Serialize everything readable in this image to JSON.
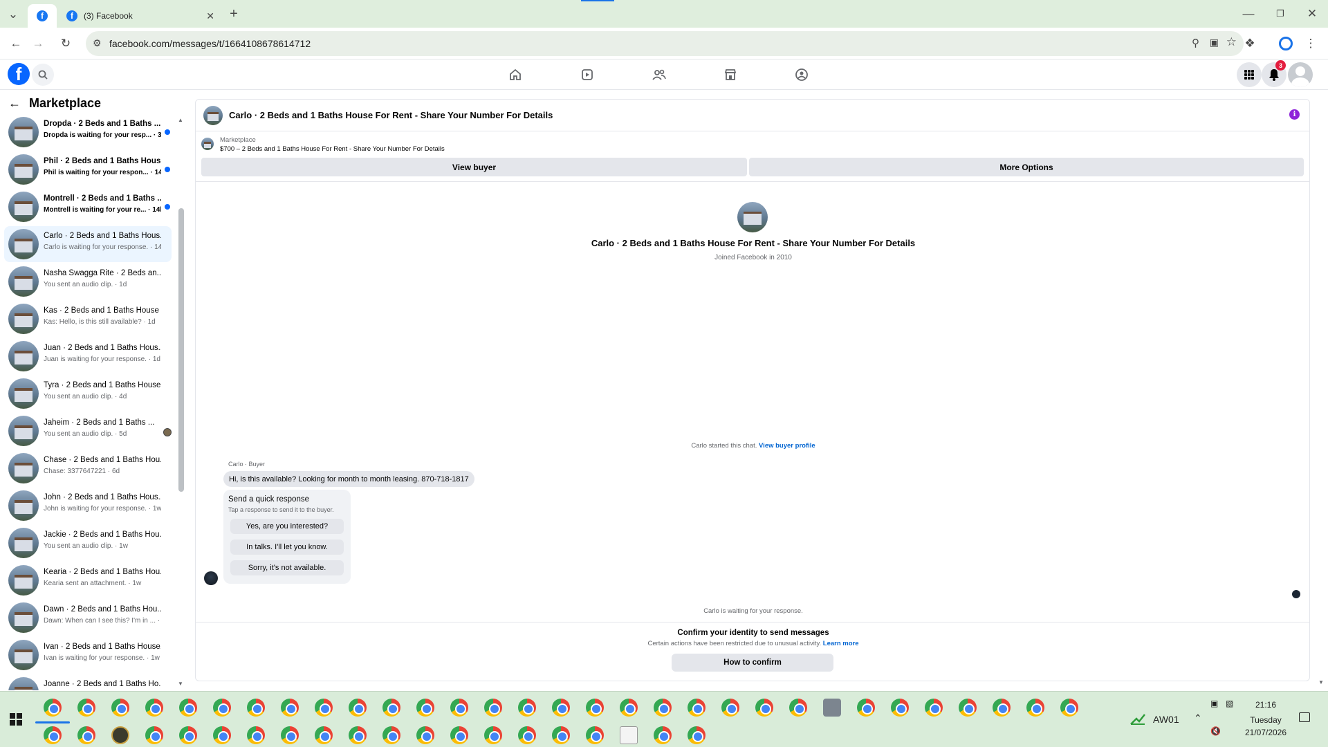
{
  "browser": {
    "tab_title": "(3) Facebook",
    "url": "facebook.com/messages/t/1664108678614712"
  },
  "fb": {
    "notification_count": "3"
  },
  "sidebar": {
    "title": "Marketplace",
    "conversations": [
      {
        "name": "Dropda · 2 Beds and 1 Baths ...",
        "snippet": "Dropda is waiting for your resp... · 3h",
        "unread": true
      },
      {
        "name": "Phil · 2 Beds and 1 Baths Hous...",
        "snippet": "Phil is waiting for your respon... · 14h",
        "unread": true
      },
      {
        "name": "Montrell · 2 Beds and 1 Baths ...",
        "snippet": "Montrell is waiting for your re... · 14h",
        "unread": true
      },
      {
        "name": "Carlo · 2 Beds and 1 Baths Hous...",
        "snippet": "Carlo is waiting for your response. · 14h",
        "selected": true
      },
      {
        "name": "Nasha Swagga Rite · 2 Beds an...",
        "snippet": "You sent an audio clip. · 1d"
      },
      {
        "name": "Kas · 2 Beds and 1 Baths House ...",
        "snippet": "Kas: Hello, is this still available? · 1d"
      },
      {
        "name": "Juan · 2 Beds and 1 Baths Hous...",
        "snippet": "Juan is waiting for your response. · 1d"
      },
      {
        "name": "Tyra · 2 Beds and 1 Baths House...",
        "snippet": "You sent an audio clip. · 4d"
      },
      {
        "name": "Jaheim · 2 Beds and 1 Baths ...",
        "snippet": "You sent an audio clip. · 5d",
        "seen": true
      },
      {
        "name": "Chase · 2 Beds and 1 Baths Hou...",
        "snippet": "Chase: 3377647221 · 6d"
      },
      {
        "name": "John · 2 Beds and 1 Baths Hous...",
        "snippet": "John is waiting for your response. · 1w"
      },
      {
        "name": "Jackie · 2 Beds and 1 Baths Hou...",
        "snippet": "You sent an audio clip. · 1w"
      },
      {
        "name": "Kearia · 2 Beds and 1 Baths Hou...",
        "snippet": "Kearia sent an attachment. · 1w"
      },
      {
        "name": "Dawn · 2 Beds and 1 Baths Hou...",
        "snippet": "Dawn: When can I see this? I'm in ... · 1w"
      },
      {
        "name": "Ivan · 2 Beds and 1 Baths House...",
        "snippet": "Ivan is waiting for your response. · 1w"
      },
      {
        "name": "Joanne · 2 Beds and 1 Baths Ho...",
        "snippet": ""
      }
    ]
  },
  "chat": {
    "title": "Carlo · 2 Beds and 1 Baths House For Rent - Share Your Number For Details",
    "listing_label": "Marketplace",
    "listing_detail": "$700 – 2 Beds and 1 Baths House For Rent - Share Your Number For Details",
    "view_buyer": "View buyer",
    "more_options": "More Options",
    "profile_name": "Carlo · 2 Beds and 1 Baths House For Rent - Share Your Number For Details",
    "joined": "Joined Facebook in 2010",
    "started_text": "Carlo started this chat.",
    "view_buyer_profile": "View buyer profile",
    "sender_label": "Carlo · Buyer",
    "message": "Hi, is this available? Looking for month to month leasing. 870-718-1817",
    "quick_title": "Send a quick response",
    "quick_sub": "Tap a response to send it to the buyer.",
    "quick_responses": [
      "Yes, are you interested?",
      "In talks. I'll let you know.",
      "Sorry, it's not available."
    ],
    "waiting": "Carlo is waiting for your response.",
    "confirm_title": "Confirm your identity to send messages",
    "confirm_sub": "Certain actions have been restricted due to unusual activity.",
    "learn_more": "Learn more",
    "how_to_confirm": "How to confirm"
  },
  "taskbar": {
    "network_label": "AW01",
    "time": "21:16",
    "day": "Tuesday",
    "date": "21/07/2026"
  },
  "icons": [
    "facebook-logo-icon",
    "search-icon",
    "home-icon",
    "video-icon",
    "friends-icon",
    "marketplace-icon",
    "groups-icon",
    "menu-grid-icon",
    "bell-icon",
    "account-icon",
    "back-arrow-icon",
    "info-icon",
    "chrome-icon",
    "windows-start-icon"
  ]
}
